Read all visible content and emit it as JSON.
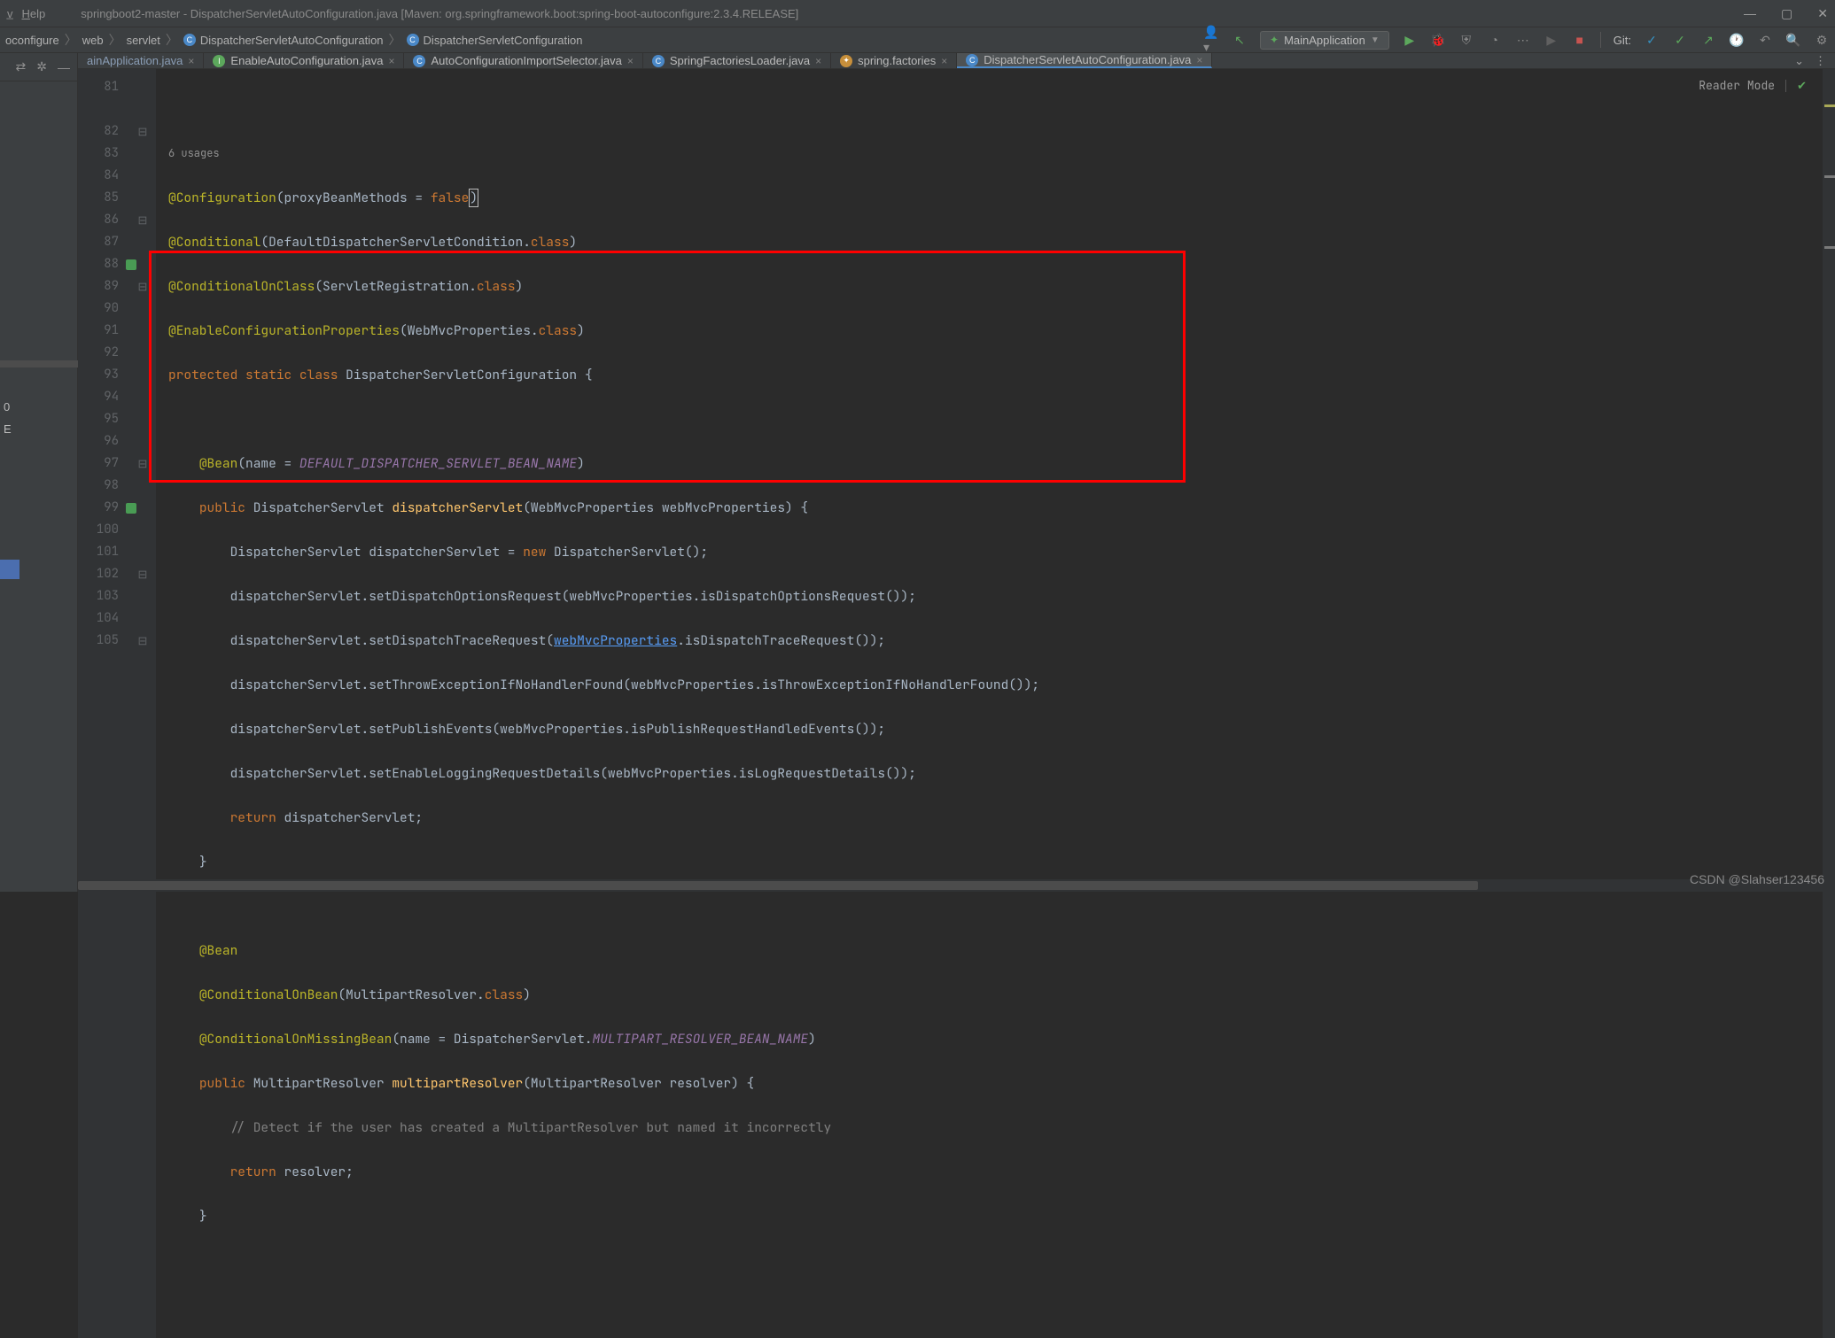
{
  "titlebar": {
    "menu": {
      "item1": "v",
      "item2": "Help"
    },
    "title": "springboot2-master - DispatcherServletAutoConfiguration.java [Maven: org.springframework.boot:spring-boot-autoconfigure:2.3.4.RELEASE]"
  },
  "breadcrumb": {
    "c1": "oconfigure",
    "c2": "web",
    "c3": "servlet",
    "c4": "DispatcherServletAutoConfiguration",
    "c5": "DispatcherServletConfiguration"
  },
  "runconfig": {
    "label": "MainApplication"
  },
  "git": {
    "label": "Git:"
  },
  "tabs": [
    {
      "label": "ainApplication.java",
      "icon": "fc-blue",
      "close": true,
      "cut": true
    },
    {
      "label": "EnableAutoConfiguration.java",
      "icon": "fc-green",
      "close": true
    },
    {
      "label": "AutoConfigurationImportSelector.java",
      "icon": "fc-blue",
      "close": true
    },
    {
      "label": "SpringFactoriesLoader.java",
      "icon": "fc-blue",
      "close": true
    },
    {
      "label": "spring.factories",
      "icon": "fc-orange",
      "close": true
    },
    {
      "label": "DispatcherServletAutoConfiguration.java",
      "icon": "fc-blue",
      "close": true,
      "active": true
    }
  ],
  "reader": {
    "label": "Reader Mode"
  },
  "usages": {
    "label": "6 usages"
  },
  "code": {
    "l82": {
      "anno": "@Configuration",
      "p1": "(proxyBeanMethods = ",
      "kw": "false",
      "p2": ")"
    },
    "l83": {
      "anno": "@Conditional",
      "p1": "(DefaultDispatcherServletCondition.",
      "kw": "class",
      "p2": ")"
    },
    "l84": {
      "anno": "@ConditionalOnClass",
      "p1": "(ServletRegistration.",
      "kw": "class",
      "p2": ")"
    },
    "l85": {
      "anno": "@EnableConfigurationProperties",
      "p1": "(WebMvcProperties.",
      "kw": "class",
      "p2": ")"
    },
    "l86": {
      "kw1": "protected",
      "kw2": "static",
      "kw3": "class",
      "name": "DispatcherServletConfiguration",
      "b": " {"
    },
    "l88": {
      "anno": "@Bean",
      "p1": "(name = ",
      "const": "DEFAULT_DISPATCHER_SERVLET_BEAN_NAME",
      "p2": ")"
    },
    "l89": {
      "kw": "public",
      "t": " DispatcherServlet ",
      "m": "dispatcherServlet",
      "p": "(WebMvcProperties webMvcProperties) {"
    },
    "l90": {
      "t1": "DispatcherServlet dispatcherServlet = ",
      "kw": "new",
      "t2": " DispatcherServlet();"
    },
    "l91": {
      "t": "dispatcherServlet.setDispatchOptionsRequest(webMvcProperties.isDispatchOptionsRequest());"
    },
    "l92": {
      "t1": "dispatcherServlet.setDispatchTraceRequest(",
      "link": "webMvcProperties",
      "t2": ".isDispatchTraceRequest());"
    },
    "l93": {
      "t": "dispatcherServlet.setThrowExceptionIfNoHandlerFound(webMvcProperties.isThrowExceptionIfNoHandlerFound());"
    },
    "l94": {
      "t": "dispatcherServlet.setPublishEvents(webMvcProperties.isPublishRequestHandledEvents());"
    },
    "l95": {
      "t": "dispatcherServlet.setEnableLoggingRequestDetails(webMvcProperties.isLogRequestDetails());"
    },
    "l96": {
      "kw": "return",
      "t": " dispatcherServlet;"
    },
    "l97": {
      "b": "}"
    },
    "l99": {
      "anno": "@Bean"
    },
    "l100": {
      "anno": "@ConditionalOnBean",
      "p1": "(MultipartResolver.",
      "kw": "class",
      "p2": ")"
    },
    "l101": {
      "anno": "@ConditionalOnMissingBean",
      "p1": "(name = DispatcherServlet.",
      "const": "MULTIPART_RESOLVER_BEAN_NAME",
      "p2": ")"
    },
    "l102": {
      "kw": "public",
      "t": " MultipartResolver ",
      "m": "multipartResolver",
      "p": "(MultipartResolver resolver) {"
    },
    "l103": {
      "c": "// Detect if the user has created a MultipartResolver but named it incorrectly"
    },
    "l104": {
      "kw": "return",
      "t": " resolver;"
    },
    "l105": {
      "b": "}"
    }
  },
  "lines": [
    "81",
    "82",
    "83",
    "84",
    "85",
    "86",
    "87",
    "88",
    "89",
    "90",
    "91",
    "92",
    "93",
    "94",
    "95",
    "96",
    "97",
    "98",
    "99",
    "100",
    "101",
    "102",
    "103",
    "104",
    "105"
  ],
  "watermark": "CSDN @Slahser123456",
  "sidebar": {
    "label1": "0",
    "label2": "E"
  }
}
